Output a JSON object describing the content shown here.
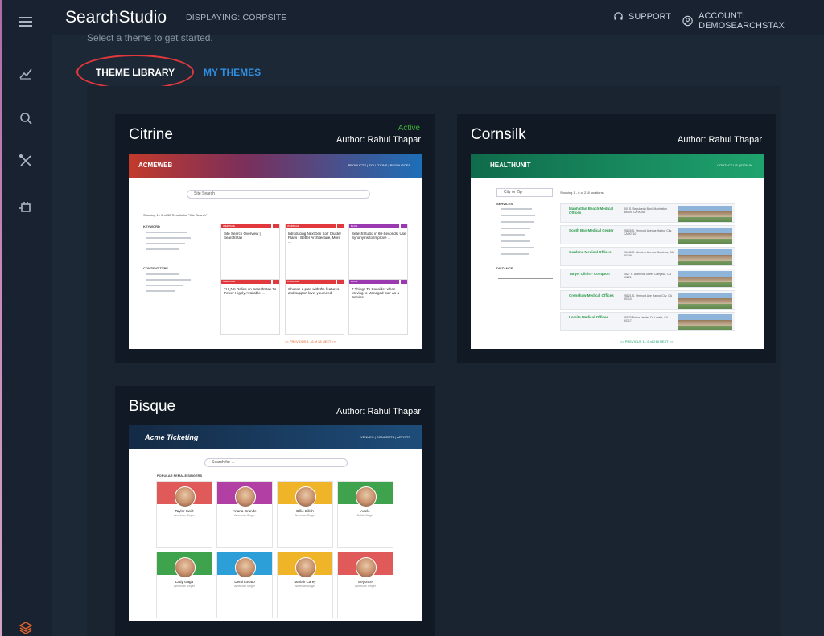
{
  "app": {
    "brand": "SearchStudio",
    "displaying": "DISPLAYING: CORPSITE",
    "support": "SUPPORT",
    "account": "ACCOUNT: DEMOSEARCHSTAX"
  },
  "rail": {
    "icons": [
      "menu-icon",
      "chart-icon",
      "search-icon",
      "tools-icon",
      "plugin-icon",
      "layers-icon"
    ]
  },
  "page": {
    "subtitle": "Select a theme to get started.",
    "tabs": [
      {
        "label": "THEME LIBRARY",
        "selected": true
      },
      {
        "label": "MY THEMES",
        "selected": false
      }
    ]
  },
  "themes": [
    {
      "name": "Citrine",
      "status": "Active",
      "author": "Author: Rahul Thapar",
      "preview": {
        "logo": "ACMEWEB",
        "nav": "PRODUCTS | SOLUTIONS | RESOURCES",
        "search": "Site Search",
        "results_text": "Showing 1 - 6 of 38 Results for \"Site Search\"",
        "facet1": "KEYWORD",
        "facet2": "CONTENT TYPE",
        "cards": [
          {
            "tag": "WEBPAGE",
            "title": "Site Search Overview | SearchStax"
          },
          {
            "tag": "WEBPAGE",
            "title": "Introducing NextGen Solr Cluster Plans - Better Architecture, More ..."
          },
          {
            "tag": "BLOG",
            "title": "SearchStudio in 60-Seconds: Use Synonyms to Improve ..."
          },
          {
            "tag": "WEBPAGE",
            "title": "TH_NK Relies on SearchStax To Power Highly Available ..."
          },
          {
            "tag": "WEBPAGE",
            "title": "Choose a plan with the features and support level you need"
          },
          {
            "tag": "BLOG",
            "title": "7 Things To Consider when Moving to Managed Solr-as-a-Service"
          }
        ],
        "pager": "<< PREVIOUS  1 - 6 of 38  NEXT >>"
      }
    },
    {
      "name": "Cornsilk",
      "status": "",
      "author": "Author: Rahul Thapar",
      "preview": {
        "logo": "HEALTHUNIT",
        "nav": "CONTACT US | SIGN IN",
        "search": "City or Zip",
        "results_text": "Showing 1 - 6 of 218 locations",
        "facet1": "SERVICES",
        "facet2": "DISTANCE",
        "locations": [
          {
            "name": "Manhattan Beach Medical Offices",
            "addr": "400 S. Sepulveda Blvd. Manhattan Beach, CA 90266"
          },
          {
            "name": "South Bay Medical Center",
            "addr": "25825 S. Vermont Avenue Harbor City, CA 90710"
          },
          {
            "name": "Gardena Medical Offices",
            "addr": "15446 S. Western Avenue Gardena, CA 90249"
          },
          {
            "name": "Target Clinic - Compton",
            "addr": "1527 S. Alameda Street Compton, CA 90221"
          },
          {
            "name": "Crenshaw Medical Offices",
            "addr": "25821 S. Vermont Ave Harbor City, CA 90710"
          },
          {
            "name": "Lomita Medical Offices",
            "addr": "25870 Pallos Verdes Dr Lomita, CA 90717"
          }
        ],
        "pager": "<< PREVIOUS  1 - 6 of 218  NEXT >>"
      }
    },
    {
      "name": "Bisque",
      "status": "",
      "author": "Author: Rahul Thapar",
      "preview": {
        "logo": "Acme Ticketing",
        "nav": "VENUES | CONCERTS | ARTISTS",
        "search": "Search for ...",
        "section": "POPULAR FEMALE SINGERS",
        "people": [
          {
            "name": "Taylor Swift",
            "role": "American Singer",
            "color": "#e05a5a"
          },
          {
            "name": "Ariana Grande",
            "role": "American Singer",
            "color": "#b23fa4"
          },
          {
            "name": "Billie Eilish",
            "role": "American Singer",
            "color": "#f0b429"
          },
          {
            "name": "Adele",
            "role": "British Singer",
            "color": "#3fa34d"
          },
          {
            "name": "Lady Gaga",
            "role": "American Singer",
            "color": "#3fa34d"
          },
          {
            "name": "Demi Lovato",
            "role": "American Singer",
            "color": "#2d9fd8"
          },
          {
            "name": "Mariah Carey",
            "role": "American Singer",
            "color": "#f0b429"
          },
          {
            "name": "Beyonce",
            "role": "American Singer",
            "color": "#e05a5a"
          }
        ]
      }
    }
  ],
  "colors": {
    "accent": "#2f8fe3",
    "highlight_ring": "#e0383d",
    "active": "#3fae3a",
    "citrine_header": "#1d6fb8",
    "cornsilk_header": "#1fa36e",
    "bisque_header": "#1e4d7a"
  }
}
